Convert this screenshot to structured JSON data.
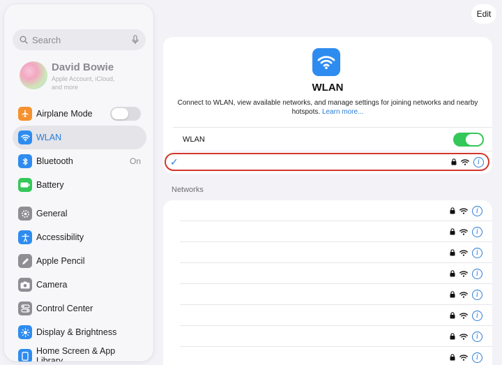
{
  "edit_label": "Edit",
  "search": {
    "placeholder": "Search"
  },
  "profile": {
    "name": "David Bowie",
    "subtitle": "Apple Account, iCloud, and more"
  },
  "sidebar": {
    "items": [
      {
        "label": "Airplane Mode",
        "icon": "airplane-icon",
        "color": "#f5912f",
        "control": "toggle-off"
      },
      {
        "label": "WLAN",
        "icon": "wifi-icon",
        "color": "#2e8cf0",
        "active": true
      },
      {
        "label": "Bluetooth",
        "icon": "bluetooth-icon",
        "color": "#2e8cf0",
        "value": "On"
      },
      {
        "label": "Battery",
        "icon": "battery-icon",
        "color": "#34c759"
      },
      {
        "label": "General",
        "icon": "gear-icon",
        "color": "#8e8e93"
      },
      {
        "label": "Accessibility",
        "icon": "accessibility-icon",
        "color": "#2e8cf0"
      },
      {
        "label": "Apple Pencil",
        "icon": "pencil-icon",
        "color": "#8e8e93"
      },
      {
        "label": "Camera",
        "icon": "camera-icon",
        "color": "#8e8e93"
      },
      {
        "label": "Control Center",
        "icon": "control-center-icon",
        "color": "#8e8e93"
      },
      {
        "label": "Display & Brightness",
        "icon": "brightness-icon",
        "color": "#2e8cf0"
      },
      {
        "label": "Home Screen & App Library",
        "icon": "home-screen-icon",
        "color": "#2e8cf0"
      }
    ]
  },
  "main": {
    "title": "WLAN",
    "description": "Connect to WLAN, view available networks, and manage settings for joining networks and nearby hotspots.",
    "learn_more": "Learn more...",
    "wlan_toggle_label": "WLAN",
    "wlan_enabled": true,
    "networks_header": "Networks",
    "network_count": 8
  },
  "colors": {
    "accent": "#2a7bd6",
    "toggle_on": "#34c759",
    "highlight": "#d2352a"
  }
}
